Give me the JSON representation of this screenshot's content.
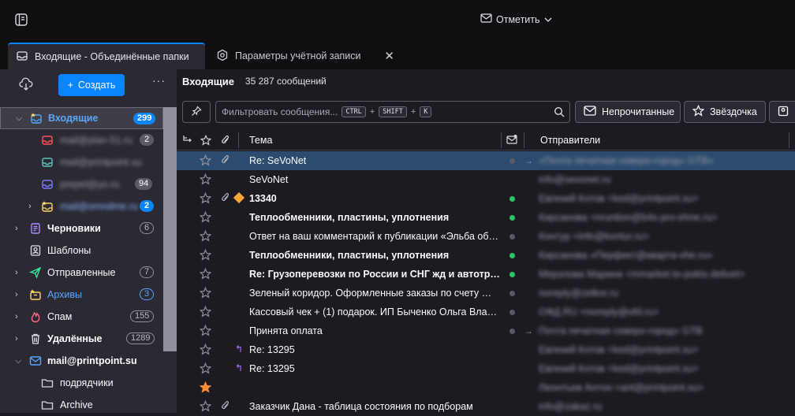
{
  "titlebar": {
    "mark_label": "Отметить"
  },
  "tabs": [
    {
      "label": "Входящие - Объединённые папки"
    },
    {
      "label": "Параметры учётной записи"
    }
  ],
  "sidebar": {
    "create_label": "Создать",
    "folders": [
      {
        "label": "Входящие",
        "badge": "299"
      },
      {
        "label": "mail@plan-51.ru",
        "badge": "2"
      },
      {
        "label": "mail@printpoint.su",
        "badge": ""
      },
      {
        "label": "prepel@yo.ru",
        "badge": "94"
      },
      {
        "label": "mail@omndme.ru",
        "badge": "2"
      },
      {
        "label": "Черновики",
        "badge": "6"
      },
      {
        "label": "Шаблоны",
        "badge": ""
      },
      {
        "label": "Отправленные",
        "badge": "7"
      },
      {
        "label": "Архивы",
        "badge": "3"
      },
      {
        "label": "Спам",
        "badge": "155"
      },
      {
        "label": "Удалённые",
        "badge": "1289"
      },
      {
        "label": "mail@printpoint.su",
        "badge": ""
      },
      {
        "label": "подрядчики",
        "badge": ""
      },
      {
        "label": "Archive",
        "badge": ""
      }
    ]
  },
  "main": {
    "title": "Входящие",
    "count": "35 287 сообщений",
    "filter_placeholder": "Фильтровать сообщения...",
    "kbd": [
      "CTRL",
      "SHIFT",
      "K"
    ],
    "quick_filters": [
      "Непрочитанные",
      "Звёздочка"
    ],
    "columns": {
      "subject": "Тема",
      "senders": "Отправители"
    }
  },
  "messages": [
    {
      "subject": "Re: SeVoNet",
      "sender": "«Почта печатная северо-город» GTB»",
      "bold": false
    },
    {
      "subject": "SeVoNet",
      "sender": "info@sevonet.ru",
      "bold": false
    },
    {
      "subject": "13340",
      "sender": "Евгений Котов <ked@printpoint.su>",
      "bold": true
    },
    {
      "subject": "Теплообменники, пластины, уплотнения",
      "sender": "Кирсанова <nruntion@b4s-pro-ehne.ru>",
      "bold": true
    },
    {
      "subject": "Ответ на ваш комментарий к публикации «Эльба обнов...",
      "sender": "Контур <info@kontur.ru>",
      "bold": false
    },
    {
      "subject": "Теплообменники, пластины, уплотнения",
      "sender": "Кирсанова «Перфект@кварта-vhe.ru»",
      "bold": true
    },
    {
      "subject": "Re: Грузоперевозки по России и СНГ жд и автотрансп...",
      "sender": "Мерзлова Марина <mmarket-to-pokts.delivet>",
      "bold": true
    },
    {
      "subject": "Зеленый коридор. Оформленные заказы по счету № 04...",
      "sender": "noreply@zelkor.ru",
      "bold": false
    },
    {
      "subject": "Кассовый чек + (1) подарок. ИП Быченко Ольга Владле...",
      "sender": "ОФД.RU <noreply@ofd.ru>",
      "bold": false
    },
    {
      "subject": "Принята оплата",
      "sender": "Почта печатная северо-город» GTB",
      "bold": false
    },
    {
      "subject": "Re: 13295",
      "sender": "Евгений Котов <ked@printpoint.su>",
      "bold": false
    },
    {
      "subject": "Re: 13295",
      "sender": "Евгений Котов <ked@printpoint.su>",
      "bold": false
    },
    {
      "subject": "",
      "sender": "Леонтьев Антон <ant@printpoint.su>",
      "bold": false
    },
    {
      "subject": "Заказчик Дана - таблица состояния по подборам",
      "sender": "info@zakaz.ru",
      "bold": false
    }
  ],
  "colors": {
    "accent": "#0a84ff",
    "selected_row": "#2b4c6e",
    "unread_dot": "#2ac769"
  }
}
